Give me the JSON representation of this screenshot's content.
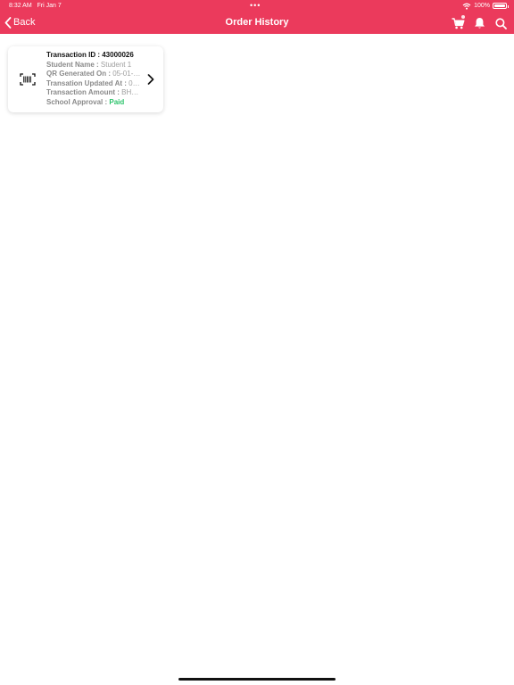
{
  "status_bar": {
    "time": "8:32 AM",
    "date": "Fri Jan 7",
    "multitask_dots": "•••",
    "battery": "100%"
  },
  "nav": {
    "back_label": "Back",
    "title": "Order History",
    "accent_color": "#eb3a5c"
  },
  "icons": {
    "back": "chevron-left-icon",
    "cart": "cart-icon",
    "notifications": "bell-icon",
    "search": "search-icon",
    "order": "barcode-icon",
    "open": "chevron-right-icon"
  },
  "orders": [
    {
      "title": "Transaction ID : 43000026",
      "fields": [
        {
          "label": "Student Name : ",
          "value": "Student 1"
        },
        {
          "label": "QR Generated On : ",
          "value": "05-01-20..."
        },
        {
          "label": "Transation Updated At : ",
          "value": "05-..."
        },
        {
          "label": "Transaction Amount : ",
          "value": "BHD 1..."
        },
        {
          "label": "School Approval : ",
          "value": "Paid",
          "value_color": "#2cc36b"
        }
      ]
    }
  ]
}
